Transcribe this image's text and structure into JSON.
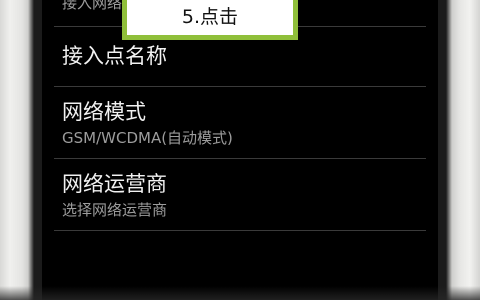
{
  "settings_list": {
    "partial_row": {
      "subtitle": "接入网络数"
    },
    "items": [
      {
        "title": "接入点名称",
        "subtitle": ""
      },
      {
        "title": "网络模式",
        "subtitle": "GSM/WCDMA(自动模式)"
      },
      {
        "title": "网络运营商",
        "subtitle": "选择网络运营商"
      }
    ]
  },
  "callout": {
    "label": "5.点击",
    "border_color": "#8fbf3a"
  }
}
